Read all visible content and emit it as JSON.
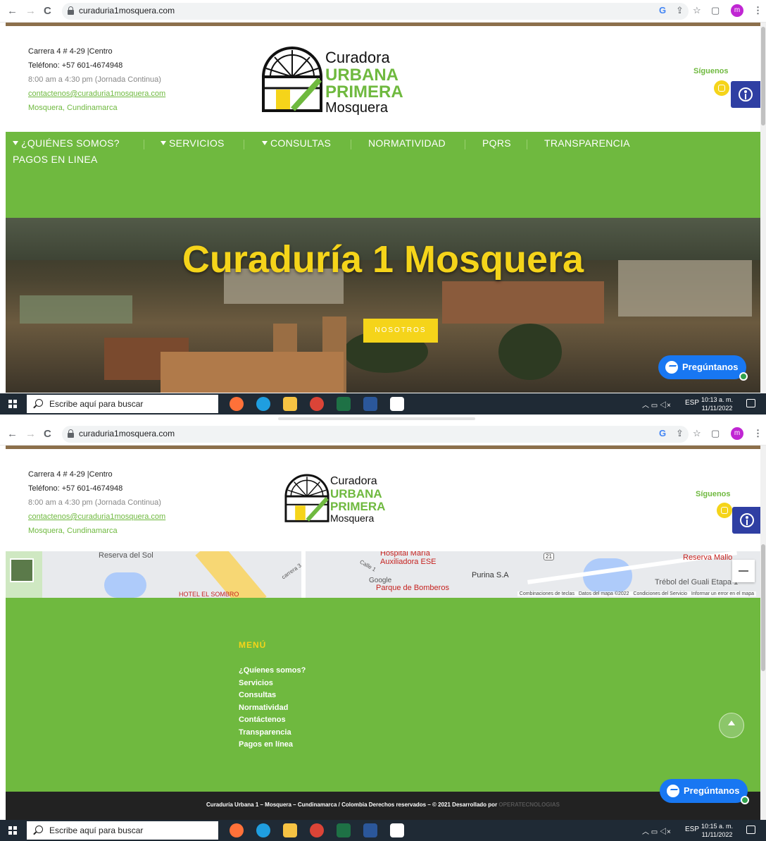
{
  "browser": {
    "url": "curaduria1mosquera.com",
    "back": "←",
    "forward": "→",
    "reload": "C",
    "profile": "m"
  },
  "header": {
    "address": "Carrera 4 # 4-29 |Centro",
    "phone": "Teléfono: +57 601-4674948",
    "hours": "8:00 am a 4:30 pm (Jornada Continua)",
    "email": "contactenos@curaduria1mosquera.com",
    "city": "Mosquera, Cundinamarca",
    "logo": {
      "line1": "Curadora",
      "line2": "URBANA",
      "line3": "PRIMERA",
      "line4": "Mosquera"
    },
    "social_label": "Síguenos"
  },
  "nav": {
    "items": [
      {
        "label": "¿QUIÉNES SOMOS?",
        "caret": true
      },
      {
        "label": "SERVICIOS",
        "caret": true
      },
      {
        "label": "CONSULTAS",
        "caret": true
      },
      {
        "label": "NORMATIVIDAD",
        "caret": false
      },
      {
        "label": "PQRS",
        "caret": false
      },
      {
        "label": "TRANSPARENCIA",
        "caret": false
      },
      {
        "label": "PAGOS EN LINEA",
        "caret": false
      }
    ]
  },
  "hero": {
    "title": "Curaduría 1 Mosquera",
    "button": "NOSOTROS"
  },
  "messenger": {
    "label": "Pregúntanos"
  },
  "taskbar": {
    "search_placeholder": "Escribe aquí para buscar",
    "lang": "ESP",
    "shot1": {
      "time": "10:13 a. m.",
      "date": "11/11/2022"
    },
    "shot2": {
      "time": "10:15 a. m.",
      "date": "11/11/2022"
    }
  },
  "map": {
    "labels": {
      "reserva_sol": "Reserva del Sol",
      "hospital1": "Hospital María",
      "hospital2": "Auxiliadora ESE",
      "calle1": "Calle 1",
      "carrera3": "carrera 3",
      "google": "Google",
      "bomberos": "Parque de Bomberos",
      "purina": "Purina S.A",
      "reserva_mallo": "Reserva Mallo",
      "trebol": "Trébol del Guali Etapa 1",
      "hotel": "HOTEL EL SOMBRO",
      "route": "21"
    },
    "footer_links": [
      "Combinaciones de teclas",
      "Datos del mapa ©2022",
      "Condiciones del Servicio",
      "Informar un error en el mapa"
    ]
  },
  "footer": {
    "menu_title": "MENÚ",
    "menu": [
      "¿Quíenes somos?",
      "Servicios",
      "Consultas",
      "Normatividad",
      "Contáctenos",
      "Transparencia",
      "Pagos en línea"
    ],
    "copyright": "Curaduría Urbana 1 – Mosquera – Cundinamarca / Colombia Derechos reservados – © 2021 Desarrollado por",
    "developer": "OPERATECNOLOGIAS"
  },
  "colors": {
    "green": "#6fb93f",
    "yellow": "#f5d41a",
    "accent_brown": "#8c6f4b",
    "a11y_blue": "#2f3fa3",
    "messenger_blue": "#1877f2",
    "dark_footer": "#222222"
  }
}
